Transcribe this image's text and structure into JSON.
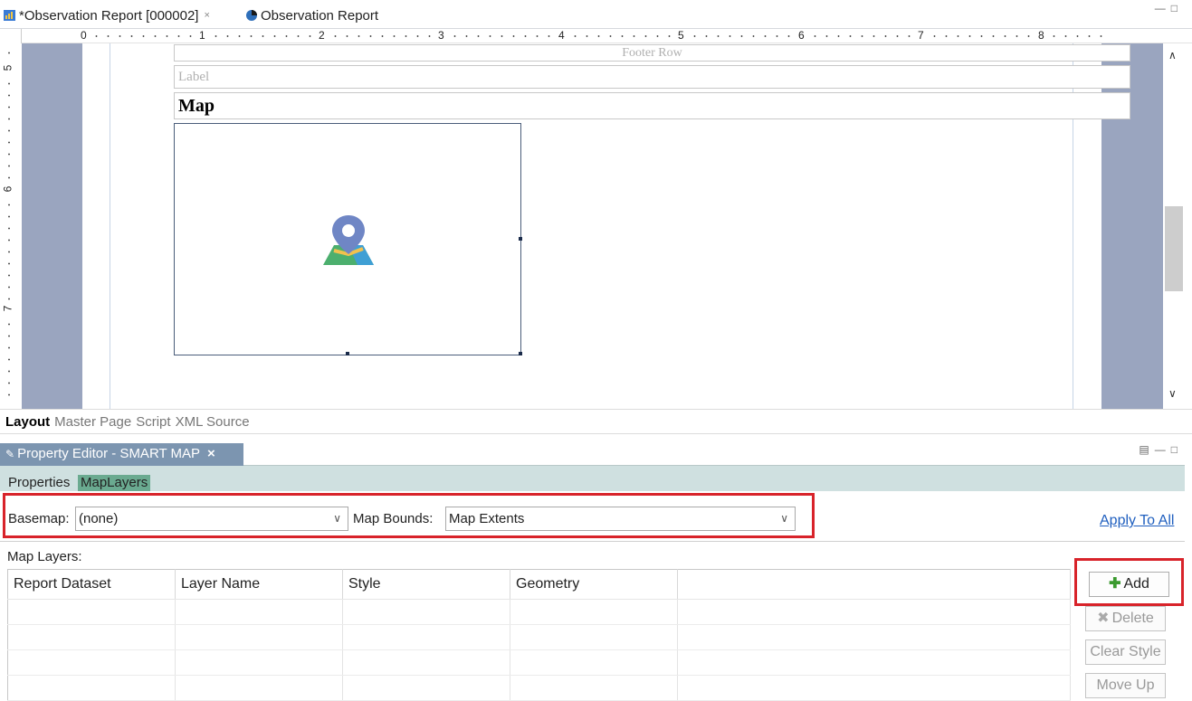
{
  "editor_tabs": [
    {
      "label": "*Observation Report [000002]",
      "close": "×",
      "icon": "report-icon"
    },
    {
      "label": "Observation Report",
      "icon": "pie-chart-icon"
    }
  ],
  "ruler": {
    "h_numbers": [
      "0",
      "1",
      "2",
      "3",
      "4",
      "5",
      "6",
      "7",
      "8"
    ],
    "v_numbers": [
      "5",
      "6",
      "7"
    ]
  },
  "design": {
    "footer_row": "Footer Row",
    "label": "Label",
    "map_title": "Map",
    "map_icon": "map-pin-icon"
  },
  "layout_tabs": [
    "Layout",
    "Master Page",
    "Script",
    "XML Source"
  ],
  "property_editor": {
    "title": "Property Editor - SMART MAP",
    "close": "×",
    "subtabs": [
      "Properties",
      "MapLayers"
    ],
    "basemap_label": "Basemap:",
    "basemap_value": "(none)",
    "bounds_label": "Map Bounds:",
    "bounds_value": "Map Extents",
    "apply_all": "Apply To All",
    "map_layers_label": "Map Layers:",
    "columns": [
      "Report Dataset",
      "Layer Name",
      "Style",
      "Geometry",
      ""
    ],
    "buttons": {
      "add": "Add",
      "delete": "Delete",
      "clear_style": "Clear Style",
      "move_up": "Move Up"
    }
  },
  "colors": {
    "highlight": "#d8232a",
    "active_subtab": "#6aaa90",
    "canvas_bg": "#9aa5bf",
    "link": "#1f5fbf"
  }
}
